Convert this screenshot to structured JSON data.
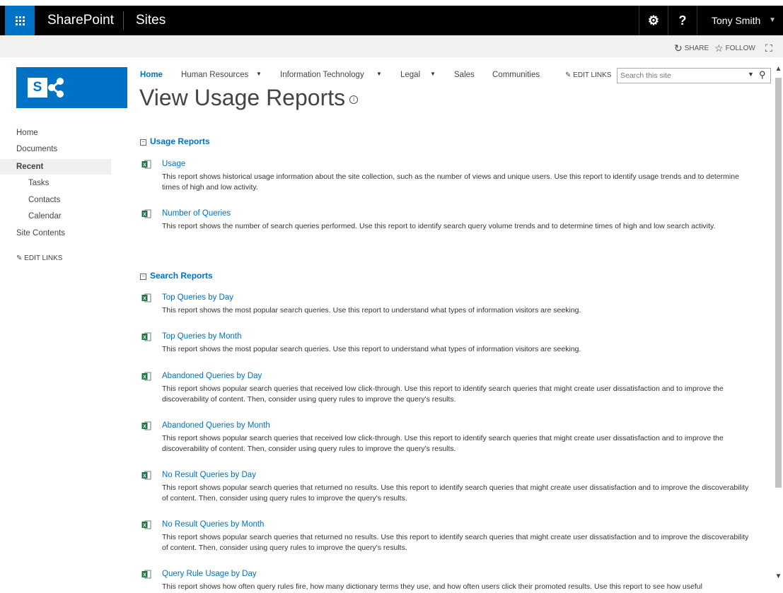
{
  "suite": {
    "brand": "SharePoint",
    "section": "Sites",
    "settings_icon": "⚙",
    "help_icon": "?",
    "user": "Tony Smith"
  },
  "ribbon": {
    "share": "SHARE",
    "follow": "FOLLOW"
  },
  "logo": {
    "letter": "S"
  },
  "topnav": {
    "items": [
      "Home",
      "Human Resources",
      "Information Technology",
      "Legal",
      "Sales",
      "Communities"
    ],
    "edit_links": "EDIT LINKS",
    "search_placeholder": "Search this site"
  },
  "page": {
    "title": "View Usage Reports",
    "info_icon": "i"
  },
  "leftnav": {
    "items": [
      "Home",
      "Documents",
      "Recent",
      "Tasks",
      "Contacts",
      "Calendar",
      "Site Contents"
    ],
    "edit_links": "EDIT LINKS"
  },
  "sections": [
    {
      "title": "Usage Reports",
      "reports": [
        {
          "name": "Usage",
          "description": "This report shows historical usage information about the site collection, such as the number of views and unique users. Use this report to identify usage trends and to determine times of high and low activity."
        },
        {
          "name": "Number of Queries",
          "description": "This report shows the number of search queries performed. Use this report to identify search query volume trends and to determine times of high and low search activity."
        }
      ]
    },
    {
      "title": "Search Reports",
      "reports": [
        {
          "name": "Top Queries by Day",
          "description": "This report shows the most popular search queries. Use this report to understand what types of information visitors are seeking."
        },
        {
          "name": "Top Queries by Month",
          "description": "This report shows the most popular search queries. Use this report to understand what types of information visitors are seeking."
        },
        {
          "name": "Abandoned Queries by Day",
          "description": "This report shows popular search queries that received low click-through. Use this report to identify search queries that might create user dissatisfaction and to improve the discoverability of content. Then, consider using query rules to improve the query's results."
        },
        {
          "name": "Abandoned Queries by Month",
          "description": "This report shows popular search queries that received low click-through. Use this report to identify search queries that might create user dissatisfaction and to improve the discoverability of content. Then, consider using query rules to improve the query's results."
        },
        {
          "name": "No Result Queries by Day",
          "description": "This report shows popular search queries that returned no results. Use this report to identify search queries that might create user dissatisfaction and to improve the discoverability of content. Then, consider using query rules to improve the query's results."
        },
        {
          "name": "No Result Queries by Month",
          "description": "This report shows popular search queries that returned no results. Use this report to identify search queries that might create user dissatisfaction and to improve the discoverability of content. Then, consider using query rules to improve the query's results."
        },
        {
          "name": "Query Rule Usage by Day",
          "description": "This report shows how often query rules fire, how many dictionary terms they use, and how often users click their promoted results. Use this report to see how useful"
        }
      ]
    }
  ],
  "colors": {
    "accent": "#0072c6",
    "suite_bar": "#000000",
    "ribbon": "#f1f1f1",
    "excel_icon": "#1e7145"
  }
}
